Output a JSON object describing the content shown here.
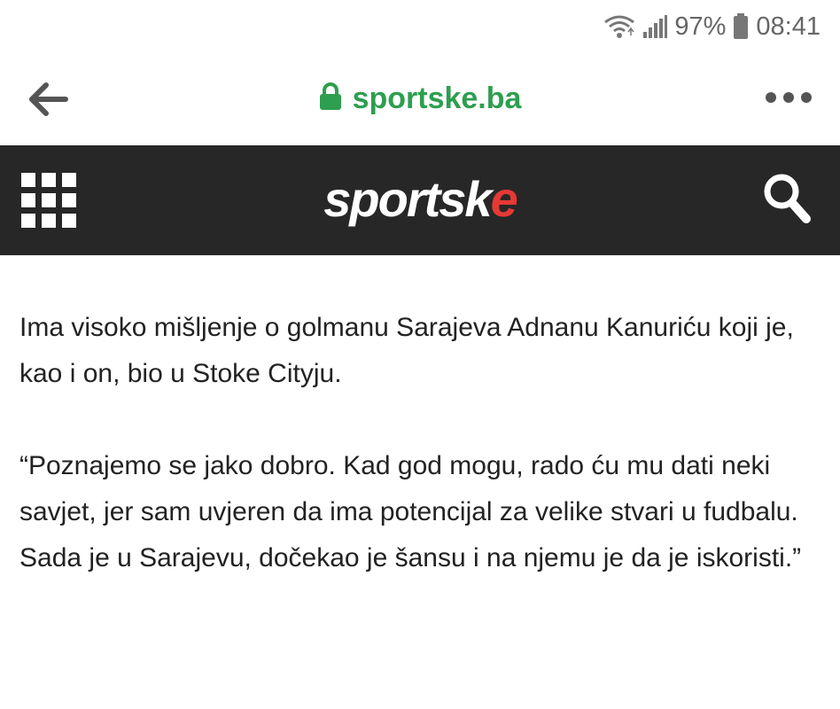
{
  "status_bar": {
    "battery": "97%",
    "time": "08:41"
  },
  "browser": {
    "url": "sportske.ba"
  },
  "site": {
    "logo_main": "sportsk",
    "logo_accent": "e"
  },
  "article": {
    "paragraphs": [
      "Ima visoko mišljenje o golmanu Sarajeva Adnanu Kanuriću koji je, kao i on, bio u Stoke Cityju.",
      "“Poznajemo se jako dobro. Kad god mogu, rado ću mu dati neki savjet, jer sam uvjeren da ima potencijal za velike stvari u fudbalu. Sada je u Sarajevu, dočekao je šansu i na njemu je da je iskoristi.”"
    ]
  },
  "icons": {
    "wifi": "wifi-icon",
    "signal": "signal-icon",
    "battery": "battery-icon",
    "back": "back-arrow-icon",
    "lock": "lock-icon",
    "menu": "more-dots-icon",
    "grid": "grid-menu-icon",
    "search": "search-icon"
  },
  "colors": {
    "url_green": "#2e9e4f",
    "header_bg": "#272727",
    "logo_accent": "#e53935"
  }
}
